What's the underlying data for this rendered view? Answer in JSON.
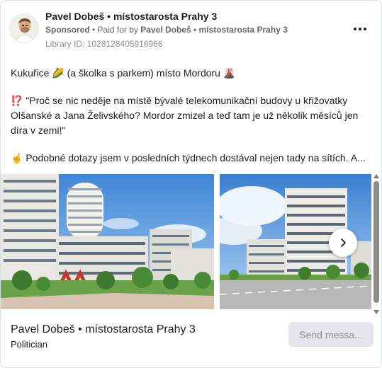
{
  "header": {
    "page_name": "Pavel Dobeš • místostarosta Prahy 3",
    "sponsored_label": "Sponsored",
    "paid_for_prefix": " • Paid for by ",
    "payer": "Pavel Dobeš • místostarosta Prahy 3",
    "library_id": "Library ID: 1028128405916966",
    "more_icon": "more-horizontal-icon"
  },
  "post": {
    "line1": "Kukuřice 🌽 (a školka s parkem) místo Mordoru 🌋",
    "line2": "⁉️ \"Proč se nic neděje na místě bývalé telekomunikační budovy u křižovatky Olšanské a Jana Želivského? Mordor zmizel a teď tam je už několik měsíců jen díra v zemi!\"",
    "line3": "☝️ Podobné dotazy jsem v posledních týdnech dostával nejen tady na sítích. A..."
  },
  "carousel": {
    "next_icon": "chevron-right-icon"
  },
  "footer": {
    "name": "Pavel Dobeš • místostarosta Prahy 3",
    "subtitle": "Politician",
    "send_button": "Send messa..."
  },
  "colors": {
    "text": "#1c1e21",
    "secondary": "#65676b",
    "button_bg": "#e4e6eb"
  }
}
